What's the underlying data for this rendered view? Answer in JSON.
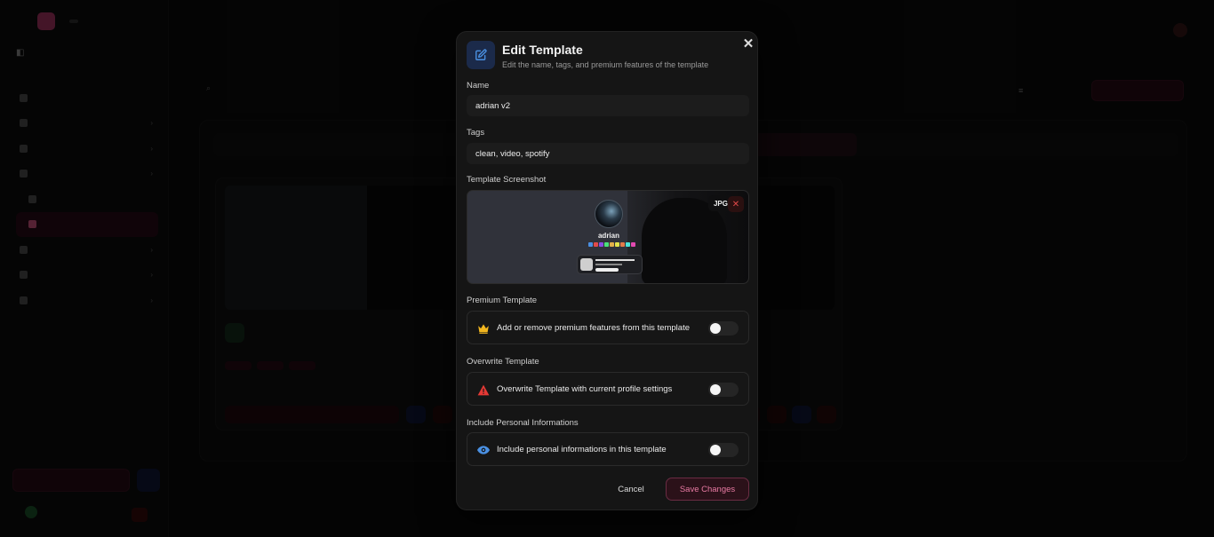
{
  "modal": {
    "title": "Edit Template",
    "subtitle": "Edit the name, tags, and premium features of the template",
    "close_icon": "close-icon",
    "name": {
      "label": "Name",
      "value": "adrian v2"
    },
    "tags": {
      "label": "Tags",
      "value": "clean, video, spotify"
    },
    "screenshot": {
      "label": "Template Screenshot",
      "format_badge": "JPG",
      "profile_name": "adrian"
    },
    "premium": {
      "section_label": "Premium Template",
      "text": "Add or remove premium features from this template",
      "icon": "crown-icon",
      "icon_color": "#f2b61f",
      "enabled": false
    },
    "overwrite": {
      "section_label": "Overwrite Template",
      "text": "Overwrite Template with current profile settings",
      "icon": "warning-icon",
      "icon_color": "#e53935",
      "enabled": false
    },
    "personal": {
      "section_label": "Include Personal Informations",
      "text": "Include personal informations in this template",
      "icon": "eye-icon",
      "icon_color": "#4a90e2",
      "enabled": false
    },
    "cancel_label": "Cancel",
    "save_label": "Save Changes"
  },
  "colors": {
    "accent": "#e87aa3",
    "edit_icon": "#4a90e2"
  }
}
